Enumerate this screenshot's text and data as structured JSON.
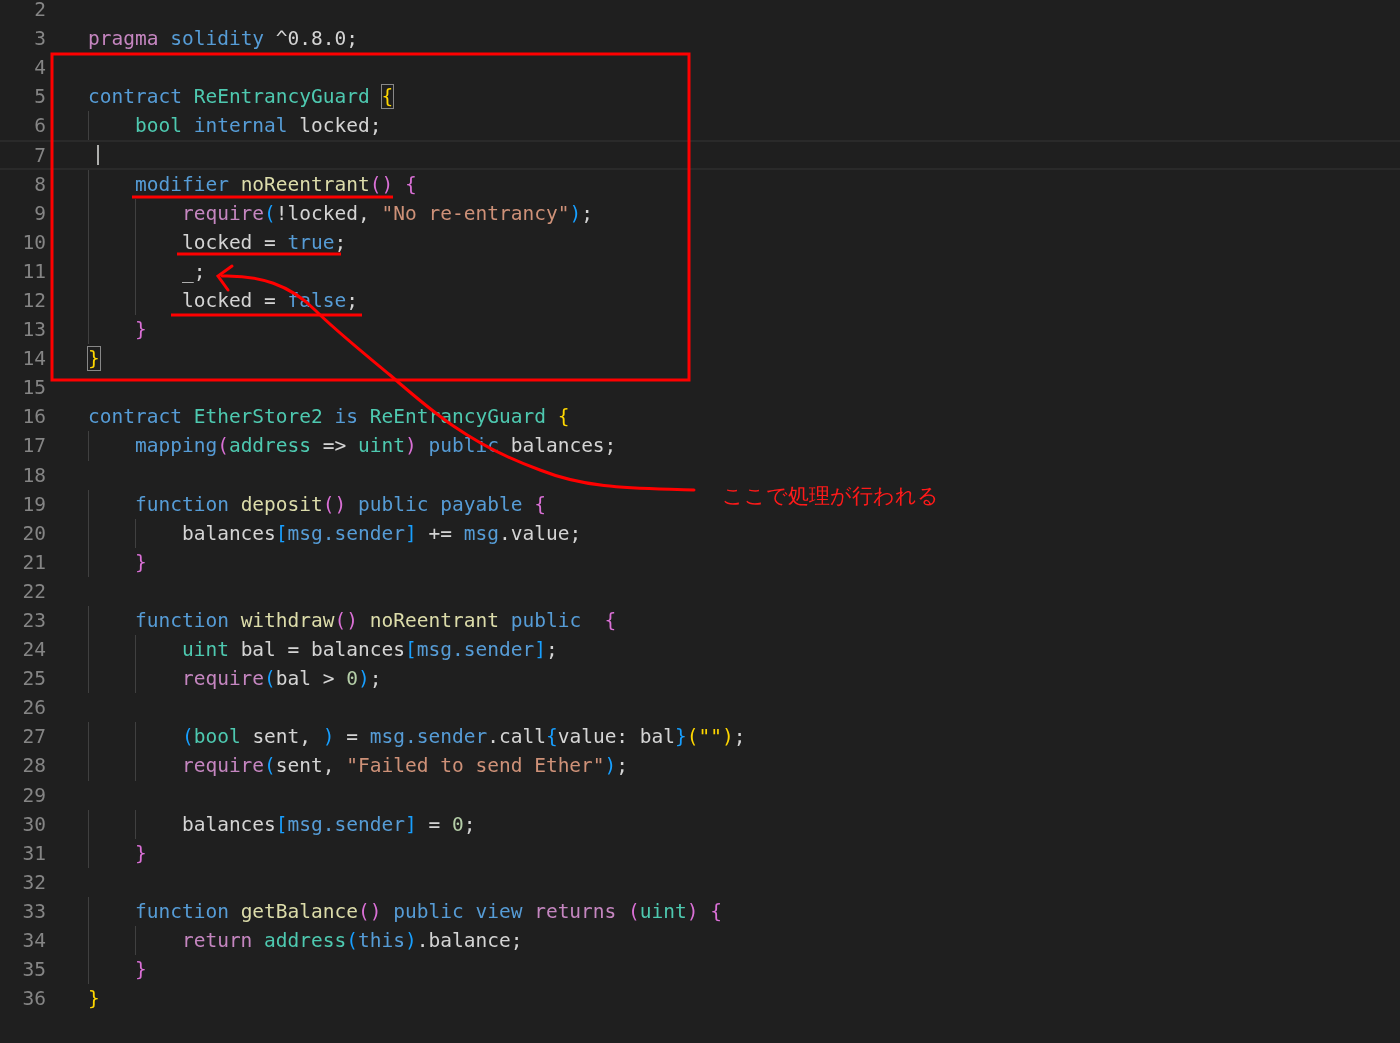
{
  "editor": {
    "lines": [
      {
        "n": "2",
        "current": false
      },
      {
        "n": "3",
        "current": false,
        "tokens": [
          {
            "t": "pragma",
            "kind": "kw"
          },
          {
            "t": " solidity",
            "kind": "st"
          },
          {
            "t": " ^0.8.0;",
            "kind": "tx"
          }
        ]
      },
      {
        "n": "4",
        "current": false
      },
      {
        "n": "5",
        "current": false,
        "tokens": [
          {
            "t": "contract",
            "kind": "st"
          },
          {
            "t": " ReEntrancyGuard ",
            "kind": "ty"
          },
          {
            "t": "{",
            "kind": "b1",
            "matched": true
          }
        ]
      },
      {
        "n": "6",
        "current": false,
        "tokens": [
          {
            "t": "    bool",
            "kind": "ty"
          },
          {
            "t": " internal",
            "kind": "st"
          },
          {
            "t": " locked;",
            "kind": "tx"
          }
        ]
      },
      {
        "n": "7",
        "current": true
      },
      {
        "n": "8",
        "current": false,
        "tokens": [
          {
            "t": "    modifier",
            "kind": "st"
          },
          {
            "t": " noReentrant",
            "kind": "fn"
          },
          {
            "t": "()",
            "kind": "b2"
          },
          {
            "t": " {",
            "kind": "b2"
          }
        ]
      },
      {
        "n": "9",
        "current": false,
        "tokens": [
          {
            "t": "        require",
            "kind": "kw"
          },
          {
            "t": "(",
            "kind": "b3"
          },
          {
            "t": "!locked, ",
            "kind": "tx"
          },
          {
            "t": "\"No re-entrancy\"",
            "kind": "str"
          },
          {
            "t": ")",
            "kind": "b3"
          },
          {
            "t": ";",
            "kind": "tx"
          }
        ]
      },
      {
        "n": "10",
        "current": false,
        "tokens": [
          {
            "t": "        locked = ",
            "kind": "tx"
          },
          {
            "t": "true",
            "kind": "st"
          },
          {
            "t": ";",
            "kind": "tx"
          }
        ]
      },
      {
        "n": "11",
        "current": false,
        "tokens": [
          {
            "t": "        _;",
            "kind": "tx"
          }
        ]
      },
      {
        "n": "12",
        "current": false,
        "tokens": [
          {
            "t": "        locked = ",
            "kind": "tx"
          },
          {
            "t": "false",
            "kind": "st"
          },
          {
            "t": ";",
            "kind": "tx"
          }
        ]
      },
      {
        "n": "13",
        "current": false,
        "tokens": [
          {
            "t": "    }",
            "kind": "b2"
          }
        ]
      },
      {
        "n": "14",
        "current": false,
        "tokens": [
          {
            "t": "}",
            "kind": "b1",
            "matched": true
          }
        ]
      },
      {
        "n": "15",
        "current": false
      },
      {
        "n": "16",
        "current": false,
        "tokens": [
          {
            "t": "contract",
            "kind": "st"
          },
          {
            "t": " EtherStore2",
            "kind": "ty"
          },
          {
            "t": " is",
            "kind": "st"
          },
          {
            "t": " ReEntrancyGuard",
            "kind": "ty"
          },
          {
            "t": " {",
            "kind": "b1",
            "matched": false
          }
        ]
      },
      {
        "n": "17",
        "current": false,
        "tokens": [
          {
            "t": "    mapping",
            "kind": "st"
          },
          {
            "t": "(",
            "kind": "b2"
          },
          {
            "t": "address",
            "kind": "ty"
          },
          {
            "t": " => ",
            "kind": "tx"
          },
          {
            "t": "uint",
            "kind": "ty"
          },
          {
            "t": ")",
            "kind": "b2"
          },
          {
            "t": " public",
            "kind": "st"
          },
          {
            "t": " balances;",
            "kind": "tx"
          }
        ]
      },
      {
        "n": "18",
        "current": false
      },
      {
        "n": "19",
        "current": false,
        "tokens": [
          {
            "t": "    function",
            "kind": "st"
          },
          {
            "t": " deposit",
            "kind": "fn"
          },
          {
            "t": "()",
            "kind": "b2"
          },
          {
            "t": " public payable",
            "kind": "st"
          },
          {
            "t": " {",
            "kind": "b2"
          }
        ]
      },
      {
        "n": "20",
        "current": false,
        "tokens": [
          {
            "t": "        balances",
            "kind": "tx"
          },
          {
            "t": "[",
            "kind": "b3"
          },
          {
            "t": "msg.sender",
            "kind": "st"
          },
          {
            "t": "]",
            "kind": "b3"
          },
          {
            "t": " += ",
            "kind": "tx"
          },
          {
            "t": "msg",
            "kind": "st"
          },
          {
            "t": ".value;",
            "kind": "tx"
          }
        ]
      },
      {
        "n": "21",
        "current": false,
        "tokens": [
          {
            "t": "    }",
            "kind": "b2"
          }
        ]
      },
      {
        "n": "22",
        "current": false
      },
      {
        "n": "23",
        "current": false,
        "tokens": [
          {
            "t": "    function",
            "kind": "st"
          },
          {
            "t": " withdraw",
            "kind": "fn"
          },
          {
            "t": "()",
            "kind": "b2"
          },
          {
            "t": " noReentrant",
            "kind": "fn"
          },
          {
            "t": " public",
            "kind": "st"
          },
          {
            "t": "  {",
            "kind": "b2"
          }
        ]
      },
      {
        "n": "24",
        "current": false,
        "tokens": [
          {
            "t": "        uint",
            "kind": "ty"
          },
          {
            "t": " bal = balances",
            "kind": "tx"
          },
          {
            "t": "[",
            "kind": "b3"
          },
          {
            "t": "msg.sender",
            "kind": "st"
          },
          {
            "t": "]",
            "kind": "b3"
          },
          {
            "t": ";",
            "kind": "tx"
          }
        ]
      },
      {
        "n": "25",
        "current": false,
        "tokens": [
          {
            "t": "        require",
            "kind": "kw"
          },
          {
            "t": "(",
            "kind": "b3"
          },
          {
            "t": "bal > ",
            "kind": "tx"
          },
          {
            "t": "0",
            "kind": "num"
          },
          {
            "t": ")",
            "kind": "b3"
          },
          {
            "t": ";",
            "kind": "tx"
          }
        ]
      },
      {
        "n": "26",
        "current": false
      },
      {
        "n": "27",
        "current": false,
        "tokens": [
          {
            "t": "        (",
            "kind": "b3"
          },
          {
            "t": "bool",
            "kind": "ty"
          },
          {
            "t": " sent, ",
            "kind": "tx"
          },
          {
            "t": ")",
            "kind": "b3"
          },
          {
            "t": " = ",
            "kind": "tx"
          },
          {
            "t": "msg.sender",
            "kind": "st"
          },
          {
            "t": ".call",
            "kind": "tx"
          },
          {
            "t": "{",
            "kind": "b3"
          },
          {
            "t": "value: bal",
            "kind": "tx"
          },
          {
            "t": "}",
            "kind": "b3"
          },
          {
            "t": "(\"\")",
            "kind": "b1",
            "matched": false
          },
          {
            "t": ";",
            "kind": "tx"
          }
        ]
      },
      {
        "n": "28",
        "current": false,
        "tokens": [
          {
            "t": "        require",
            "kind": "kw"
          },
          {
            "t": "(",
            "kind": "b3"
          },
          {
            "t": "sent, ",
            "kind": "tx"
          },
          {
            "t": "\"Failed to send Ether\"",
            "kind": "str"
          },
          {
            "t": ")",
            "kind": "b3"
          },
          {
            "t": ";",
            "kind": "tx"
          }
        ]
      },
      {
        "n": "29",
        "current": false
      },
      {
        "n": "30",
        "current": false,
        "tokens": [
          {
            "t": "        balances",
            "kind": "tx"
          },
          {
            "t": "[",
            "kind": "b3"
          },
          {
            "t": "msg.sender",
            "kind": "st"
          },
          {
            "t": "]",
            "kind": "b3"
          },
          {
            "t": " = ",
            "kind": "tx"
          },
          {
            "t": "0",
            "kind": "num"
          },
          {
            "t": ";",
            "kind": "tx"
          }
        ]
      },
      {
        "n": "31",
        "current": false,
        "tokens": [
          {
            "t": "    }",
            "kind": "b2"
          }
        ]
      },
      {
        "n": "32",
        "current": false
      },
      {
        "n": "33",
        "current": false,
        "tokens": [
          {
            "t": "    function",
            "kind": "st"
          },
          {
            "t": " getBalance",
            "kind": "fn"
          },
          {
            "t": "()",
            "kind": "b2"
          },
          {
            "t": " public view",
            "kind": "st"
          },
          {
            "t": " returns",
            "kind": "kw"
          },
          {
            "t": " (",
            "kind": "b2"
          },
          {
            "t": "uint",
            "kind": "ty"
          },
          {
            "t": ")",
            "kind": "b2"
          },
          {
            "t": " {",
            "kind": "b2"
          }
        ]
      },
      {
        "n": "34",
        "current": false,
        "tokens": [
          {
            "t": "        return",
            "kind": "kw"
          },
          {
            "t": " address",
            "kind": "ty"
          },
          {
            "t": "(",
            "kind": "b3"
          },
          {
            "t": "this",
            "kind": "st"
          },
          {
            "t": ")",
            "kind": "b3"
          },
          {
            "t": ".balance;",
            "kind": "tx"
          }
        ]
      },
      {
        "n": "35",
        "current": false,
        "tokens": [
          {
            "t": "    }",
            "kind": "b2"
          }
        ]
      },
      {
        "n": "36",
        "current": false,
        "tokens": [
          {
            "t": "}",
            "kind": "b1",
            "matched": false
          }
        ]
      }
    ]
  },
  "annotation": {
    "label": "ここで処理が行われる"
  }
}
